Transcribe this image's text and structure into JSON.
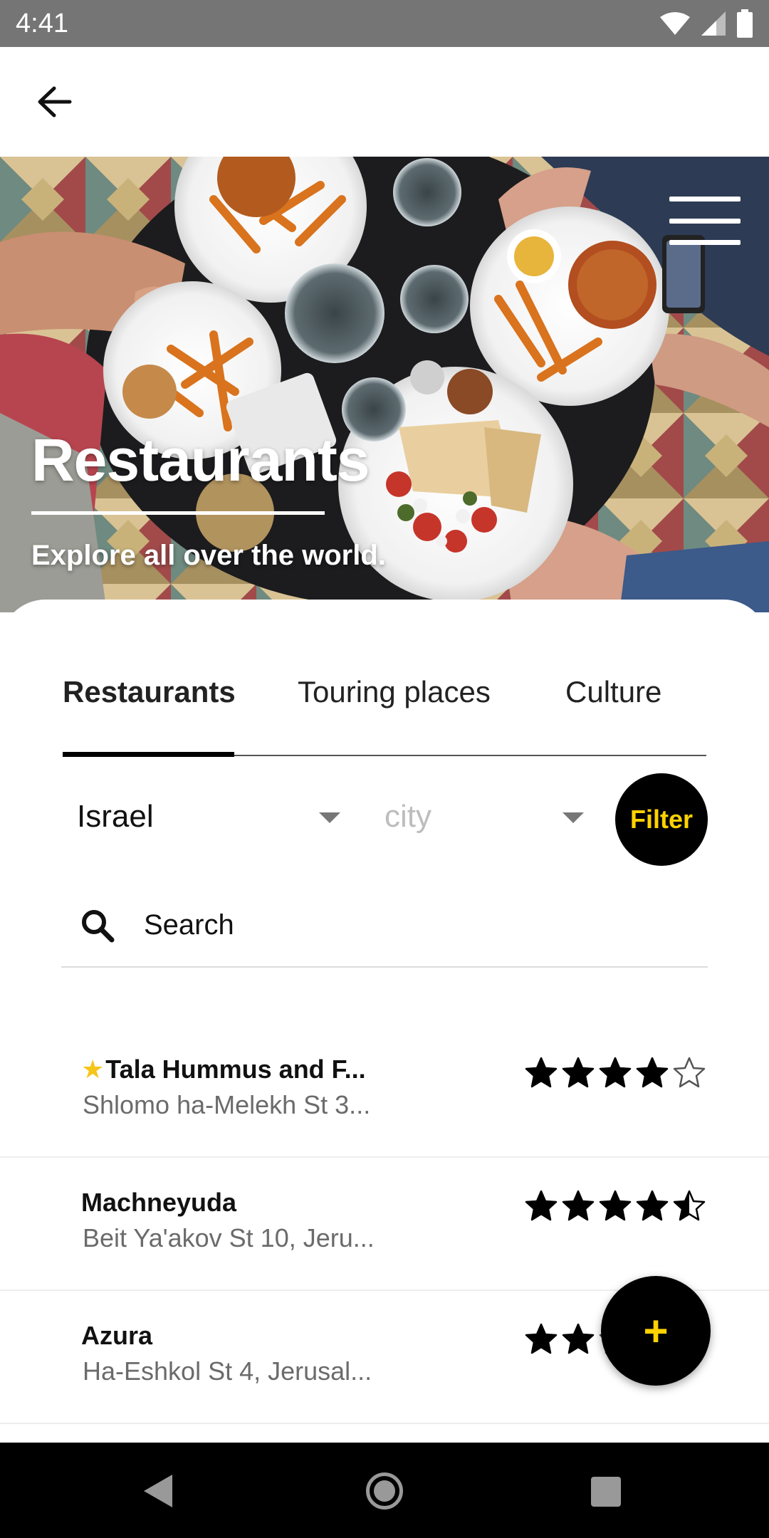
{
  "status_bar": {
    "time": "4:41",
    "icons": [
      "wifi-icon",
      "cellular-signal-icon",
      "battery-icon"
    ]
  },
  "app_bar": {
    "back_icon": "arrow-left-icon"
  },
  "hero": {
    "title": "Restaurants",
    "subtitle": "Explore all over the world.",
    "menu_icon": "menu-icon",
    "image": "table-of-food-photo"
  },
  "tabs": [
    {
      "label": "Restaurants",
      "active": true
    },
    {
      "label": "Touring places",
      "active": false
    },
    {
      "label": "Culture",
      "active": false
    }
  ],
  "filters": {
    "country_value": "Israel",
    "city_placeholder": "city",
    "filter_label": "Filter"
  },
  "search": {
    "placeholder": "Search"
  },
  "restaurants": [
    {
      "name": "Tala Hummus and F...",
      "address": "Shlomo ha-Melekh St 3...",
      "rating": 4,
      "favorite": true
    },
    {
      "name": "Machneyuda",
      "address": "Beit Ya'akov St 10, Jeru...",
      "rating": 4.5,
      "favorite": false
    },
    {
      "name": "Azura",
      "address": "Ha-Eshkol St 4, Jerusal...",
      "rating": 2,
      "favorite": false
    }
  ],
  "fab": {
    "label": "+"
  },
  "colors": {
    "accent": "#ffd200",
    "primary": "#000000",
    "status_bar": "#757575",
    "muted_text": "#6b6b6b",
    "favorite_star": "#f5c518"
  }
}
